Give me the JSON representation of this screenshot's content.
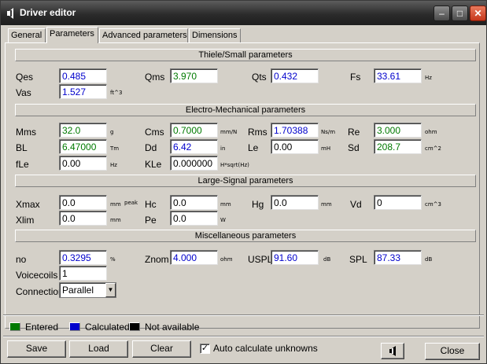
{
  "window": {
    "title": "Driver editor",
    "minimize": "‒",
    "maximize": "□",
    "close": "✕"
  },
  "tabs": [
    {
      "label": "General"
    },
    {
      "label": "Parameters"
    },
    {
      "label": "Advanced parameters"
    },
    {
      "label": "Dimensions"
    }
  ],
  "sections": {
    "thiele_small": "Thiele/Small parameters",
    "electro_mechanical": "Electro-Mechanical parameters",
    "large_signal": "Large-Signal parameters",
    "misc": "Miscellaneous parameters"
  },
  "params": {
    "qes": {
      "label": "Qes",
      "value": "0.485",
      "status": "calculated",
      "unit": ""
    },
    "qms": {
      "label": "Qms",
      "value": "3.970",
      "status": "entered",
      "unit": ""
    },
    "qts": {
      "label": "Qts",
      "value": "0.432",
      "status": "calculated",
      "unit": ""
    },
    "fs": {
      "label": "Fs",
      "value": "33.61",
      "status": "calculated",
      "unit": "Hz"
    },
    "vas": {
      "label": "Vas",
      "value": "1.527",
      "status": "calculated",
      "unit": "ft^3"
    },
    "mms": {
      "label": "Mms",
      "value": "32.0",
      "status": "entered",
      "unit": "g"
    },
    "cms": {
      "label": "Cms",
      "value": "0.7000",
      "status": "entered",
      "unit": "mm/N"
    },
    "rms": {
      "label": "Rms",
      "value": "1.70388",
      "status": "calculated",
      "unit": "Ns/m"
    },
    "re": {
      "label": "Re",
      "value": "3.000",
      "status": "entered",
      "unit": "ohm"
    },
    "bl": {
      "label": "BL",
      "value": "6.47000",
      "status": "entered",
      "unit": "Tm"
    },
    "dd": {
      "label": "Dd",
      "value": "6.42",
      "status": "calculated",
      "unit": "in"
    },
    "le": {
      "label": "Le",
      "value": "0.00",
      "status": "na",
      "unit": "mH"
    },
    "sd": {
      "label": "Sd",
      "value": "208.7",
      "status": "entered",
      "unit": "cm^2"
    },
    "fle": {
      "label": "fLe",
      "value": "0.00",
      "status": "na",
      "unit": "Hz"
    },
    "kle": {
      "label": "KLe",
      "value": "0.000000",
      "status": "na",
      "unit": "H*sqrt(Hz)"
    },
    "xmax": {
      "label": "Xmax",
      "value": "0.0",
      "status": "na",
      "unit": "mm",
      "unit2": "peak"
    },
    "hc": {
      "label": "Hc",
      "value": "0.0",
      "status": "na",
      "unit": "mm"
    },
    "hg": {
      "label": "Hg",
      "value": "0.0",
      "status": "na",
      "unit": "mm"
    },
    "vd": {
      "label": "Vd",
      "value": "0",
      "status": "na",
      "unit": "cm^3"
    },
    "xlim": {
      "label": "Xlim",
      "value": "0.0",
      "status": "na",
      "unit": "mm"
    },
    "pe": {
      "label": "Pe",
      "value": "0.0",
      "status": "na",
      "unit": "W"
    },
    "no": {
      "label": "no",
      "value": "0.3295",
      "status": "calculated",
      "unit": "%"
    },
    "znom": {
      "label": "Znom",
      "value": "4.000",
      "status": "calculated",
      "unit": "ohm"
    },
    "uspl": {
      "label": "USPL",
      "value": "91.60",
      "status": "calculated",
      "unit": "dB"
    },
    "spl": {
      "label": "SPL",
      "value": "87.33",
      "status": "calculated",
      "unit": "dB"
    },
    "voicecoils": {
      "label": "Voicecoils",
      "value": "1",
      "status": "na"
    },
    "connection": {
      "label": "Connection",
      "value": "Parallel"
    }
  },
  "legend": {
    "entered": {
      "label": "Entered",
      "color": "#007a00"
    },
    "calculated": {
      "label": "Calculated",
      "color": "#0000cc"
    },
    "na": {
      "label": "Not available",
      "color": "#000000"
    }
  },
  "buttons": {
    "save": "Save",
    "load": "Load",
    "clear": "Clear",
    "auto_calc": "Auto calculate unknowns",
    "auto_calc_checked": true,
    "close": "Close"
  }
}
